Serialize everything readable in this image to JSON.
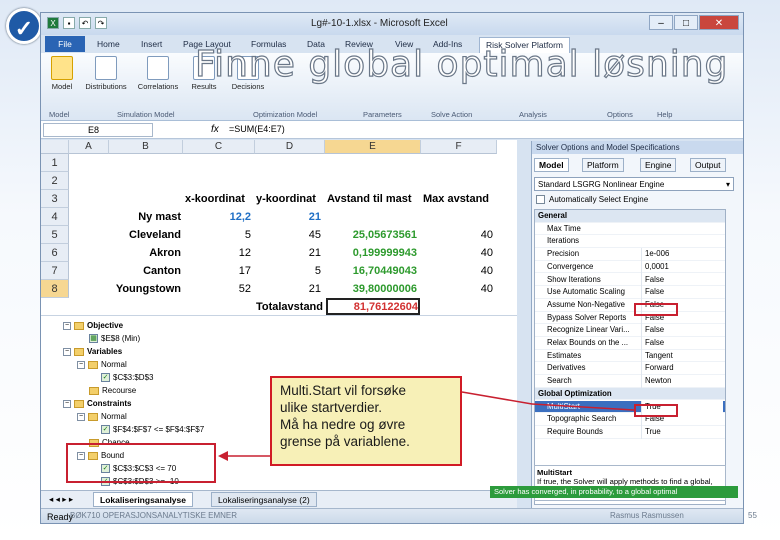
{
  "window": {
    "title": "Lg#-10-1.xlsx - Microsoft Excel",
    "controls": [
      "–",
      "□",
      "✕"
    ],
    "inner_controls": [
      "–",
      "□",
      "✕"
    ]
  },
  "overlay_title": "Finne global optimal løsning",
  "ribbon_tabs": [
    "File",
    "Home",
    "Insert",
    "Page Layout",
    "Formulas",
    "Data",
    "Review",
    "View",
    "Add-Ins",
    "Risk Solver Platform"
  ],
  "ribbon_buttons": [
    "Model",
    "Distributions",
    "Correlations",
    "Results",
    "Decisions"
  ],
  "ribbon_groups": [
    "Model",
    "Simulation Model",
    "Optimization Model",
    "Parameters",
    "Solve Action",
    "Analysis",
    "Options",
    "Help"
  ],
  "formula_bar": {
    "name_box": "E8",
    "fx": "fx",
    "formula": "=SUM(E4:E7)"
  },
  "columns": [
    "A",
    "B",
    "C",
    "D",
    "E",
    "F"
  ],
  "rows": [
    "1",
    "2",
    "3",
    "4",
    "5",
    "6",
    "7",
    "8"
  ],
  "headers": {
    "x": "x-koordinat",
    "y": "y-koordinat",
    "dist": "Avstand til mast",
    "max": "Max avstand"
  },
  "table": [
    {
      "name": "Ny mast",
      "x": "12,2",
      "y": "21",
      "dist": "",
      "max": ""
    },
    {
      "name": "Cleveland",
      "x": "5",
      "y": "45",
      "dist": "25,05673561",
      "max": "40"
    },
    {
      "name": "Akron",
      "x": "12",
      "y": "21",
      "dist": "0,199999943",
      "max": "40"
    },
    {
      "name": "Canton",
      "x": "17",
      "y": "5",
      "dist": "16,70449043",
      "max": "40"
    },
    {
      "name": "Youngstown",
      "x": "52",
      "y": "21",
      "dist": "39,80000006",
      "max": "40"
    }
  ],
  "total": {
    "label": "Totalavstand",
    "value": "81,76122604"
  },
  "tree": {
    "objective": "Objective",
    "objective_item": "$E$8 (Min)",
    "variables": "Variables",
    "normal": "Normal",
    "var_item": "$C$3:$D$3",
    "recourse": "Recourse",
    "constraints": "Constraints",
    "con_normal": "Normal",
    "con_item": "$F$4:$F$7 <= $F$4:$F$7",
    "chance": "Chance",
    "bound": "Bound",
    "bound1": "$C$3:$C$3 <= 70",
    "bound2": "$C$3:$D$3 >= -10"
  },
  "callout": {
    "line1": "Multi.Start vil forsøke",
    "line2": "ulike startverdier.",
    "line3": "Må ha nedre og øvre",
    "line4": "grense på variablene."
  },
  "sheet_tabs": [
    "Lokaliseringsanalyse",
    "Lokaliseringsanalyse (2)"
  ],
  "status": "Ready",
  "pane": {
    "title": "Solver Options and Model Specifications",
    "tabs": [
      "Model",
      "Platform",
      "Engine",
      "Output"
    ],
    "engine": "Standard LSGRG Nonlinear Engine",
    "auto_select": "Automatically Select Engine",
    "general": "General",
    "props": [
      {
        "k": "Max Time",
        "v": ""
      },
      {
        "k": "Iterations",
        "v": ""
      },
      {
        "k": "Precision",
        "v": "1e-006"
      },
      {
        "k": "Convergence",
        "v": "0,0001"
      },
      {
        "k": "Show Iterations",
        "v": "False"
      },
      {
        "k": "Use Automatic Scaling",
        "v": "False"
      },
      {
        "k": "Assume Non-Negative",
        "v": "False"
      },
      {
        "k": "Bypass Solver Reports",
        "v": "False"
      },
      {
        "k": "Recognize Linear Vari...",
        "v": "False"
      },
      {
        "k": "Relax Bounds on the ...",
        "v": "False"
      },
      {
        "k": "Estimates",
        "v": "Tangent"
      },
      {
        "k": "Derivatives",
        "v": "Forward"
      },
      {
        "k": "Search",
        "v": "Newton"
      }
    ],
    "global": "Global Optimization",
    "global_props": [
      {
        "k": "MultiStart",
        "v": "True"
      },
      {
        "k": "Topographic Search",
        "v": "False"
      },
      {
        "k": "Require Bounds",
        "v": "True"
      }
    ],
    "desc_title": "MultiStart",
    "desc": "If true, the Solver will apply methods to find a global, rather than a local, optimal solution."
  },
  "green_status": "Solver has converged, in probability, to a global optimal",
  "footer": {
    "left": "BØK710 OPERASJONSANALYTISKE EMNER",
    "right": "Rasmus Rasmussen",
    "page": "55"
  }
}
